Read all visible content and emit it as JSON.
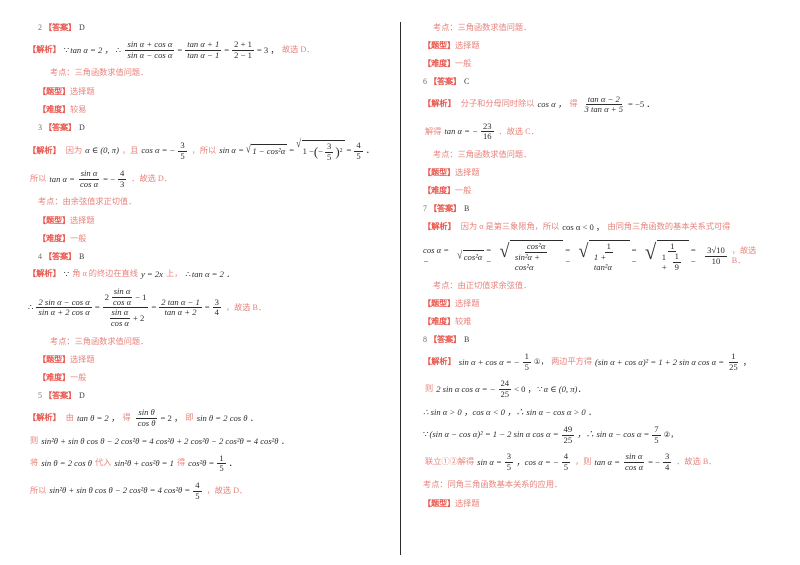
{
  "document": {
    "type": "math-answer-key",
    "colors": {
      "red_tag": "#e8534a",
      "red_text": "#e8837c",
      "math_black": "#2c2c2c",
      "divider": "#2b2b2b"
    },
    "labels": {
      "answer": "【答案】",
      "analysis": "【解析】",
      "focus": "考点：",
      "qtype": "【题型】",
      "difficulty": "【难度】"
    }
  },
  "left_column": {
    "q2": {
      "number": "2",
      "answer_label": "【答案】",
      "answer": "D",
      "analysis_label": "【解析】",
      "analysis_because": "∵",
      "tan_eq": "tan α = 2 ，",
      "therefore": "∴",
      "frac1_num": "sin α + cos α",
      "frac1_den": "sin α − cos α",
      "eq1": "=",
      "frac2_num": "tan α + 1",
      "frac2_den": "tan α − 1",
      "eq2": "=",
      "frac3_num": "2 + 1",
      "frac3_den": "2 − 1",
      "eq3": "= 3 ，",
      "conclusion": "故选 D．",
      "focus": "考点：三角函数求值问题．",
      "qtype_label": "【题型】",
      "qtype": "选择题",
      "difficulty_label": "【难度】",
      "difficulty": "较易"
    },
    "q3": {
      "number": "3",
      "answer_label": "【答案】",
      "answer": "D",
      "analysis_label": "【解析】",
      "because_text": "因为",
      "alpha_range": "α ∈ (0, π)",
      "and_text": "，且",
      "cos_value_lhs": "cos α = −",
      "cos_frac_num": "3",
      "cos_frac_den": "5",
      "so_text": "，所以",
      "sin_lhs": "sin α =",
      "sqrt1": "1 − cos²α",
      "eq": "=",
      "sqrt2_inner": "1 −",
      "inner_frac_num": "3",
      "inner_frac_den": "5",
      "inner_sign": "−",
      "inner_pow": "2",
      "result_eq": "=",
      "result_num": "4",
      "result_den": "5",
      "result_end": "．",
      "line2_lead": "所以",
      "line2_tan": "tan α =",
      "line2_frac_num": "sin α",
      "line2_frac_den": "cos α",
      "line2_eq": "= −",
      "line2_res_num": "4",
      "line2_res_den": "3",
      "line2_end": "．故选 D．",
      "focus": "考点：由余弦值求正切值．",
      "qtype_label": "【题型】",
      "qtype": "选择题",
      "difficulty_label": "【难度】",
      "difficulty": "一般"
    },
    "q4": {
      "number": "4",
      "answer_label": "【答案】",
      "answer": "B",
      "analysis_label": "【解析】",
      "because": "∵",
      "text1": "角 α 的终边在直线",
      "line_eq": "y = 2x",
      "text2": "上，",
      "therefore": "∴",
      "tan_eq": "tan α = 2 ．",
      "line2_because": "∴",
      "f1_num": "2 sin α − cos α",
      "f1_den": "sin α + 2 cos α",
      "eq1": "=",
      "f2_num_frac_num": "sin α",
      "f2_num_frac_den": "cos α",
      "f2_num_lead": "2",
      "f2_num_tail": "− 1",
      "f2_den_frac_num": "sin α",
      "f2_den_frac_den": "cos α",
      "f2_den_tail": "+ 2",
      "eq2": "=",
      "f3_num": "2 tan α − 1",
      "f3_den": "tan α + 2",
      "eq3": "=",
      "f4_num": "3",
      "f4_den": "4",
      "conclusion": "，故选 B．",
      "focus": "考点：三角函数求值问题．",
      "qtype_label": "【题型】",
      "qtype": "选择题",
      "difficulty_label": "【难度】",
      "difficulty": "一般"
    },
    "q5": {
      "number": "5",
      "answer_label": "【答案】",
      "answer": "D",
      "analysis_label": "【解析】",
      "from_text": "由",
      "tan_eq": "tan θ = 2 ，",
      "get_text": "得",
      "frac_num": "sin θ",
      "frac_den": "cos θ",
      "frac_eq": "= 2 ，",
      "then_text": "即",
      "sin_eq": "sin θ = 2 cos θ ．",
      "line2_lead": "则",
      "line2": "sin²θ + sin θ cos θ − 2 cos²θ = 4 cos²θ + 2 cos²θ − 2 cos²θ = 4 cos²θ ．",
      "line3_lead": "将",
      "line3_a": "sin θ = 2 cos θ",
      "line3_mid": "代入",
      "line3_b": "sin²θ + cos²θ = 1",
      "line3_get": "得",
      "line3_c": "cos²θ =",
      "line3_num": "1",
      "line3_den": "5",
      "line3_end": "．",
      "line4_lead": "所以",
      "line4_a": "sin²θ + sin θ cos θ − 2 cos²θ = 4 cos²θ =",
      "line4_num": "4",
      "line4_den": "5",
      "line4_end": "，故选 D．"
    }
  },
  "right_column": {
    "q5_tail": {
      "focus": "考点：三角函数求值问题．",
      "qtype_label": "【题型】",
      "qtype": "选择题",
      "difficulty_label": "【难度】",
      "difficulty": "一般"
    },
    "q6": {
      "number": "6",
      "answer_label": "【答案】",
      "answer": "C",
      "analysis_label": "【解析】",
      "text1": "分子和分母同时除以",
      "cos_text": "cos α ，",
      "get_text": "得",
      "frac_num": "tan α − 2",
      "frac_den": "3 tan α + 5",
      "frac_eq": "= −5 ．",
      "line2_lead": "解得",
      "line2_tan": "tan α = −",
      "line2_num": "23",
      "line2_den": "16",
      "line2_end": "．故选 C．",
      "focus": "考点：三角函数求值问题．",
      "qtype_label": "【题型】",
      "qtype": "选择题",
      "difficulty_label": "【难度】",
      "difficulty": "一般"
    },
    "q7": {
      "number": "7",
      "answer_label": "【答案】",
      "answer": "B",
      "analysis_label": "【解析】",
      "text1": "因为 α 是第三象限角，所以",
      "cos_lt": "cos α < 0 ，",
      "text2": "由同角三角函数的基本关系式可得",
      "m_lhs": "cos α = −",
      "m_sqrt1": "cos²α",
      "m_eq1": "= −",
      "m_f1_num": "cos²α",
      "m_f1_den": "sin²α + cos²α",
      "m_eq2": "= −",
      "m_f2_num": "1",
      "m_f2_den": "1 + tan²α",
      "m_eq3": "= −",
      "m_f3_num": "1",
      "m_f3_den_lead": "1 +",
      "m_f3_den_num": "1",
      "m_f3_den_den": "9",
      "m_eq4": "= −",
      "m_res_num": "3√10",
      "m_res_den": "10",
      "conclusion": "，故选 B．",
      "focus": "考点：由正切值求余弦值．",
      "qtype_label": "【题型】",
      "qtype": "选择题",
      "difficulty_label": "【难度】",
      "difficulty": "较难"
    },
    "q8": {
      "number": "8",
      "answer_label": "【答案】",
      "answer": "B",
      "analysis_label": "【解析】",
      "l1_a": "sin α + cos α = −",
      "l1_num": "1",
      "l1_den": "5",
      "l1_circ": "①，",
      "l1_mid": "两边平方得",
      "l1_b": "(sin α + cos α)² = 1 + 2 sin α cos α =",
      "l1_res_num": "1",
      "l1_res_den": "25",
      "l1_end": "，",
      "l2_lead": "则",
      "l2_a": "2 sin α cos α = −",
      "l2_num": "24",
      "l2_den": "25",
      "l2_b": "< 0 ，",
      "l2_because": "∵",
      "l2_c": "α ∈ (0, π)．",
      "l3": "∴ sin α > 0 ，cos α < 0 ，∴ sin α − cos α > 0 ．",
      "l4_because": "∵",
      "l4_a": "(sin α − cos α)² = 1 − 2 sin α cos α =",
      "l4_num": "49",
      "l4_den": "25",
      "l4_b": "，∴ sin α − cos α =",
      "l4_res_num": "7",
      "l4_res_den": "5",
      "l4_circ": "②，",
      "l5_lead": "联立①②解得",
      "l5_a": "sin α =",
      "l5_num1": "3",
      "l5_den1": "5",
      "l5_b": "，cos α = −",
      "l5_num2": "4",
      "l5_den2": "5",
      "l5_c": "，则",
      "l5_d": "tan α =",
      "l5_fnum": "sin α",
      "l5_fden": "cos α",
      "l5_e": "= −",
      "l5_num3": "3",
      "l5_den3": "4",
      "l5_end": "．故选 B．",
      "focus": "考点：同角三角函数基本关系的应用．",
      "qtype_label": "【题型】",
      "qtype": "选择题"
    }
  }
}
